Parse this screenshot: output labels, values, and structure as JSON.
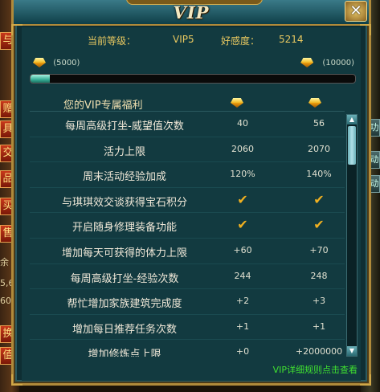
{
  "window": {
    "title": "VIP",
    "close_label": "✕"
  },
  "vip": {
    "level_label": "当前等级：",
    "level_value": "VIP5",
    "favor_label": "好感度：",
    "favor_value": "5214",
    "current_exp": "(5000)",
    "next_exp": "(10000)",
    "progress": 0.06
  },
  "benefits": {
    "header": "您的VIP专属福利",
    "rows": [
      {
        "name": "每周高级打坐-威望值次数",
        "current": "40",
        "next": "56"
      },
      {
        "name": "活力上限",
        "current": "2060",
        "next": "2070"
      },
      {
        "name": "周末活动经验加成",
        "current": "120%",
        "next": "140%"
      },
      {
        "name": "与琪琪效交谈获得宝石积分",
        "current": "check",
        "next": "check"
      },
      {
        "name": "开启随身修理装备功能",
        "current": "check",
        "next": "check"
      },
      {
        "name": "增加每天可获得的体力上限",
        "current": "+60",
        "next": "+70"
      },
      {
        "name": "每周高级打坐-经验次数",
        "current": "244",
        "next": "248"
      },
      {
        "name": "帮忙增加家族建筑完成度",
        "current": "+2",
        "next": "+3"
      },
      {
        "name": "增加每日推荐任务次数",
        "current": "+1",
        "next": "+1"
      },
      {
        "name": "增加修炼点上限",
        "current": "+0",
        "next": "+2000000"
      }
    ]
  },
  "footer": {
    "link_text": "VIP详细规则点击查看"
  },
  "side_tabs": [
    "与",
    "赠",
    "具",
    "交",
    "品",
    "买",
    "售",
    "换",
    "值"
  ],
  "side_texts": [
    "余",
    "5,6",
    "60"
  ],
  "right_tabs": [
    "功",
    "动",
    "动"
  ],
  "colors": {
    "accent_gold": "#b08a3a",
    "panel_bg": "#123a40",
    "link_green": "#40e030",
    "check_gold": "#f0b020"
  }
}
